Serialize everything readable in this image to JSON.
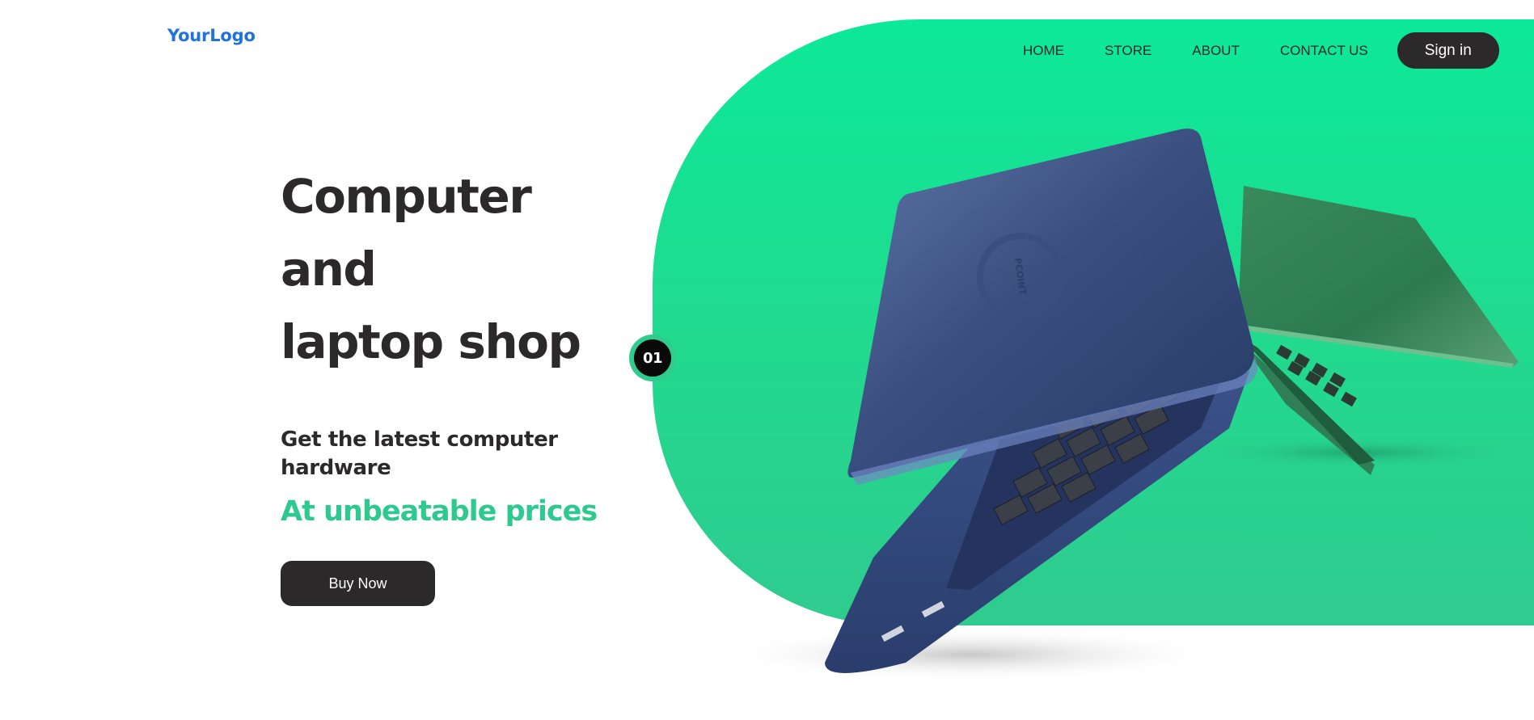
{
  "logo": {
    "text": "YourLogo"
  },
  "nav": {
    "items": [
      {
        "label": "HOME"
      },
      {
        "label": "STORE"
      },
      {
        "label": "ABOUT"
      },
      {
        "label": "CONTACT US"
      }
    ],
    "signin_label": "Sign in"
  },
  "hero": {
    "title_lines": [
      "Computer",
      "and",
      "laptop shop"
    ],
    "subtitle": "Get the latest computer hardware",
    "tagline": "At unbeatable prices",
    "cta_label": "Buy Now"
  },
  "slider": {
    "current": "01"
  },
  "product": {
    "laptop_brand": "PCOINT"
  },
  "colors": {
    "accent_green": "#0ce998",
    "tagline_green": "#2ec98e",
    "dark": "#2b292a",
    "logo_blue": "#1f73db"
  }
}
